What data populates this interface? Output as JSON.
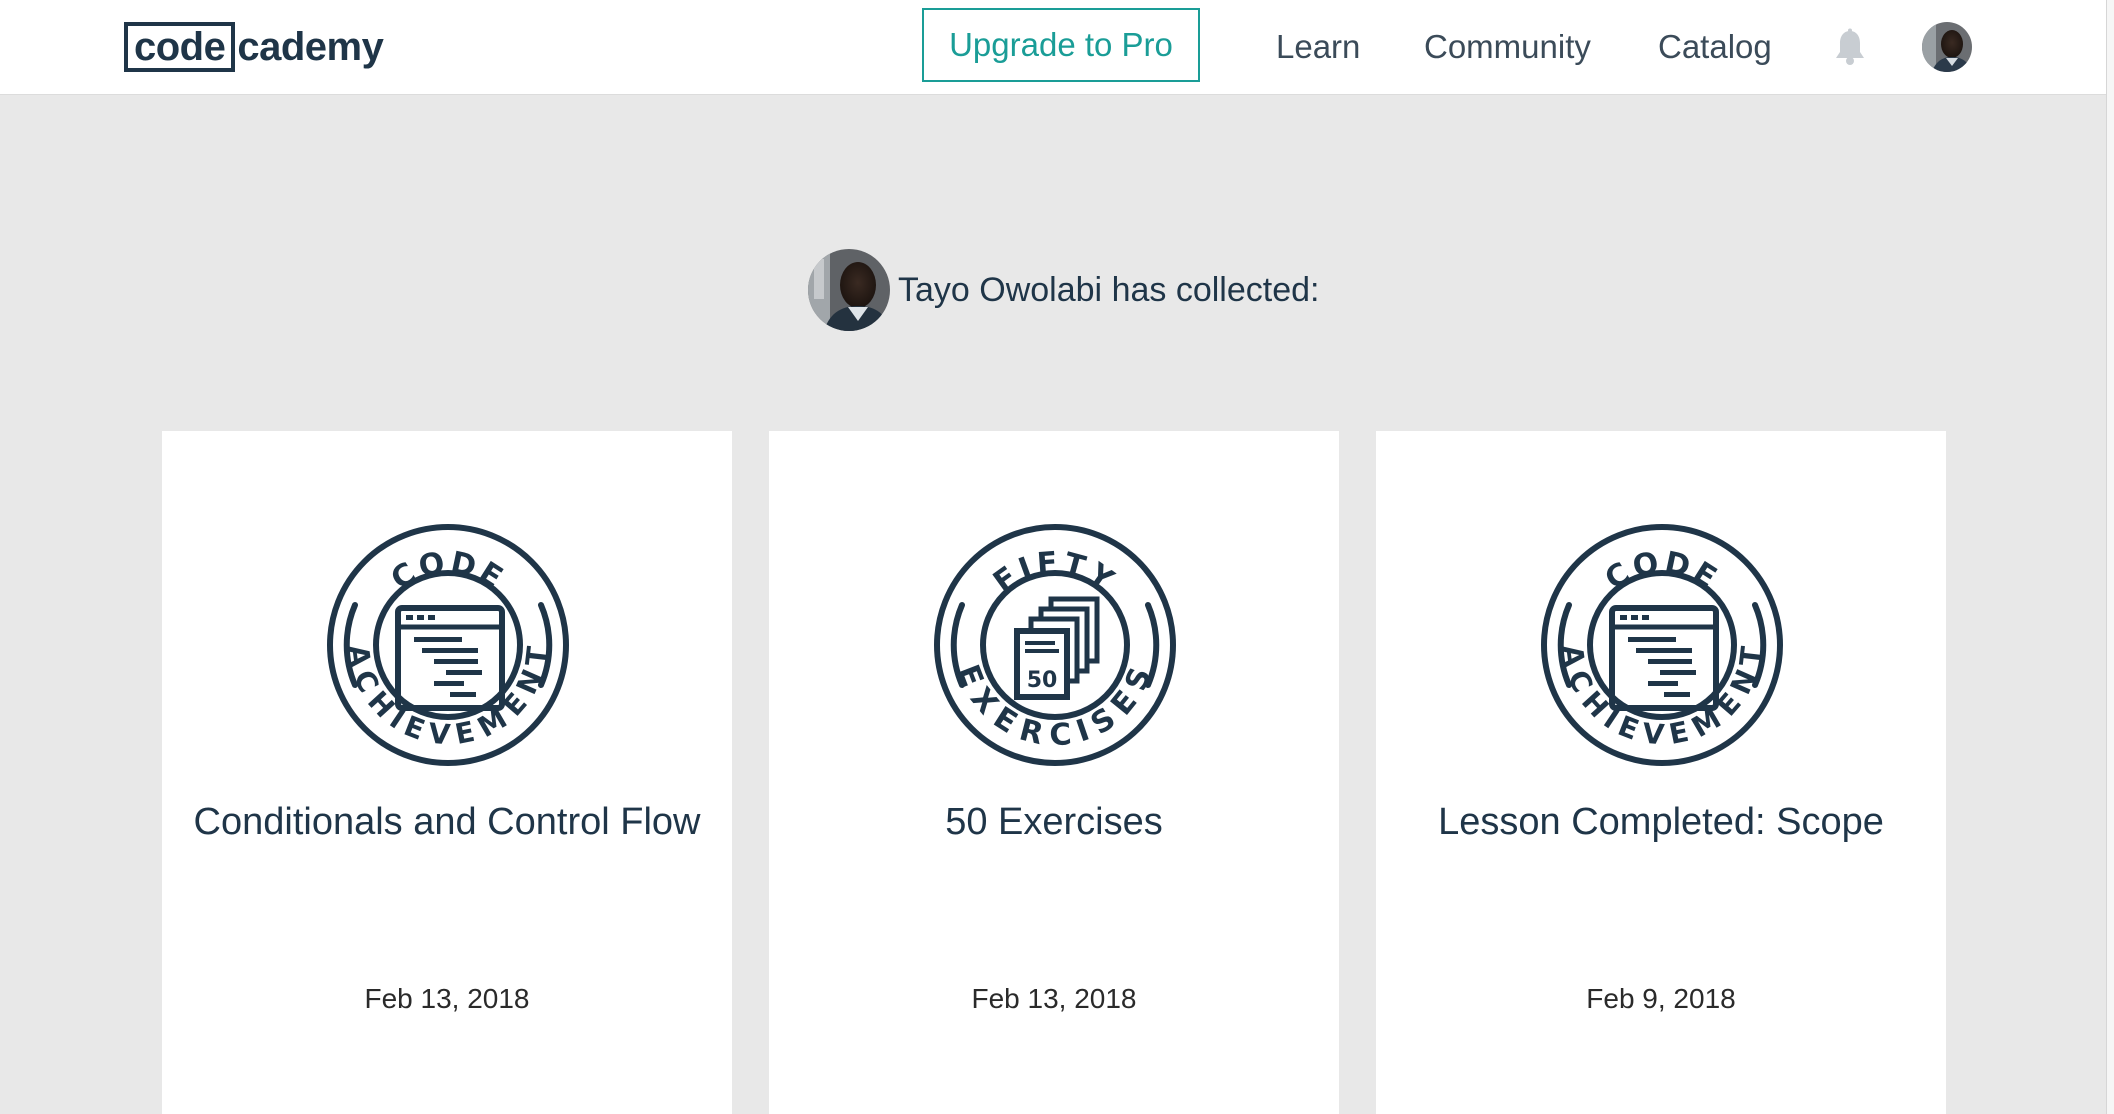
{
  "header": {
    "logo_left": "code",
    "logo_right": "cademy",
    "upgrade_label": "Upgrade to Pro",
    "nav": [
      "Learn",
      "Community",
      "Catalog"
    ],
    "icons": {
      "notifications": "bell-icon",
      "profile": "avatar"
    }
  },
  "profile": {
    "name": "Tayo Owolabi",
    "collected_text": "has collected:"
  },
  "achievements": [
    {
      "badge": "code-achievement",
      "badge_top": "CODE",
      "badge_bottom": "ACHIEVEMENT",
      "title": "Conditionals and Control Flow",
      "date": "Feb 13, 2018"
    },
    {
      "badge": "fifty-exercises",
      "badge_top": "FIFTY",
      "badge_bottom": "EXERCISES",
      "badge_number": "50",
      "title": "50 Exercises",
      "date": "Feb 13, 2018"
    },
    {
      "badge": "code-achievement",
      "badge_top": "CODE",
      "badge_bottom": "ACHIEVEMENT",
      "title": "Lesson Completed: Scope",
      "date": "Feb 9, 2018"
    }
  ],
  "colors": {
    "brand_navy": "#1f3548",
    "accent_teal": "#1a9d97",
    "page_bg": "#e8e8e8"
  }
}
